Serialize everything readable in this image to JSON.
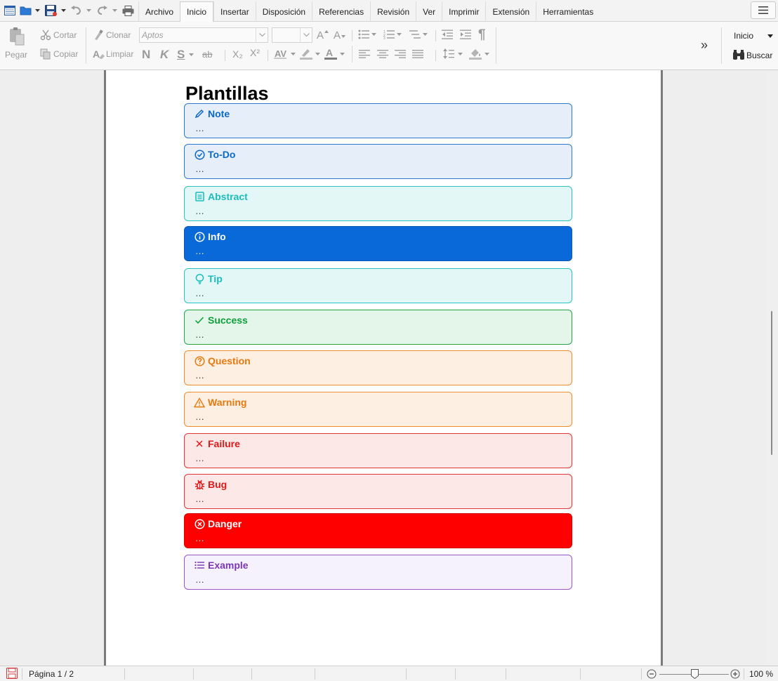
{
  "menubar": {
    "tabs": [
      "Archivo",
      "Inicio",
      "Insertar",
      "Disposición",
      "Referencias",
      "Revisión",
      "Ver",
      "Imprimir",
      "Extensión",
      "Herramientas"
    ],
    "active_tab": "Inicio"
  },
  "ribbon": {
    "paste": "Pegar",
    "cut": "Cortar",
    "copy": "Copiar",
    "clone": "Clonar",
    "clear": "Limpiar",
    "font_name": "Aptos",
    "font_size": "",
    "bold": "N",
    "italic": "K",
    "underline": "S",
    "strike": "ab",
    "subscript": "X₂",
    "superscript": "X²",
    "style_select": "Inicio",
    "find": "Buscar",
    "more": "»"
  },
  "document": {
    "title": "Plantillas",
    "callouts": [
      {
        "label": "Note",
        "body": "…",
        "icon": "pencil-icon",
        "color": "#0a69c7",
        "bg": "#e6eff9",
        "border": "#2a79cc",
        "text": "#0a69c7"
      },
      {
        "label": "To-Do",
        "body": "…",
        "icon": "check-circle-icon",
        "color": "#0a69c7",
        "bg": "#e6eff9",
        "border": "#2a79cc",
        "text": "#0a69c7"
      },
      {
        "label": "Abstract",
        "body": "…",
        "icon": "clipboard-list-icon",
        "color": "#1bbcbc",
        "bg": "#e3f7f6",
        "border": "#2cc3c3",
        "text": "#1bbcbc"
      },
      {
        "label": "Info",
        "body": "…",
        "icon": "info-circle-icon",
        "color": "#ffffff",
        "bg": "#0a69d9",
        "border": "#0a58b5",
        "text": "#ffffff"
      },
      {
        "label": "Tip",
        "body": "…",
        "icon": "lightbulb-icon",
        "color": "#1bbcbc",
        "bg": "#e3f7f6",
        "border": "#2cc3c3",
        "text": "#1bbcbc"
      },
      {
        "label": "Success",
        "body": "…",
        "icon": "check-icon",
        "color": "#0e9e3a",
        "bg": "#e4f5ea",
        "border": "#23a546",
        "text": "#0e9e3a"
      },
      {
        "label": "Question",
        "body": "…",
        "icon": "question-circle-icon",
        "color": "#e6790f",
        "bg": "#fdefe2",
        "border": "#ec8e2e",
        "text": "#e6790f"
      },
      {
        "label": "Warning",
        "body": "…",
        "icon": "warning-triangle-icon",
        "color": "#e6790f",
        "bg": "#fdefe2",
        "border": "#ec8e2e",
        "text": "#e6790f"
      },
      {
        "label": "Failure",
        "body": "…",
        "icon": "x-icon",
        "color": "#e01818",
        "bg": "#fde8e8",
        "border": "#e33636",
        "text": "#e01818"
      },
      {
        "label": "Bug",
        "body": "…",
        "icon": "bug-icon",
        "color": "#e01818",
        "bg": "#fde8e8",
        "border": "#e33636",
        "text": "#e01818"
      },
      {
        "label": "Danger",
        "body": "…",
        "icon": "x-circle-icon",
        "color": "#ffffff",
        "bg": "#ff0000",
        "border": "#dd0000",
        "text": "#ffffff"
      },
      {
        "label": "Example",
        "body": "…",
        "icon": "list-icon",
        "color": "#7a36b5",
        "bg": "#f5f2fd",
        "border": "#9858c8",
        "text": "#7a36b5"
      }
    ]
  },
  "status": {
    "page": "Página 1 / 2",
    "zoom": "100 %",
    "zoom_level": 0.5
  }
}
